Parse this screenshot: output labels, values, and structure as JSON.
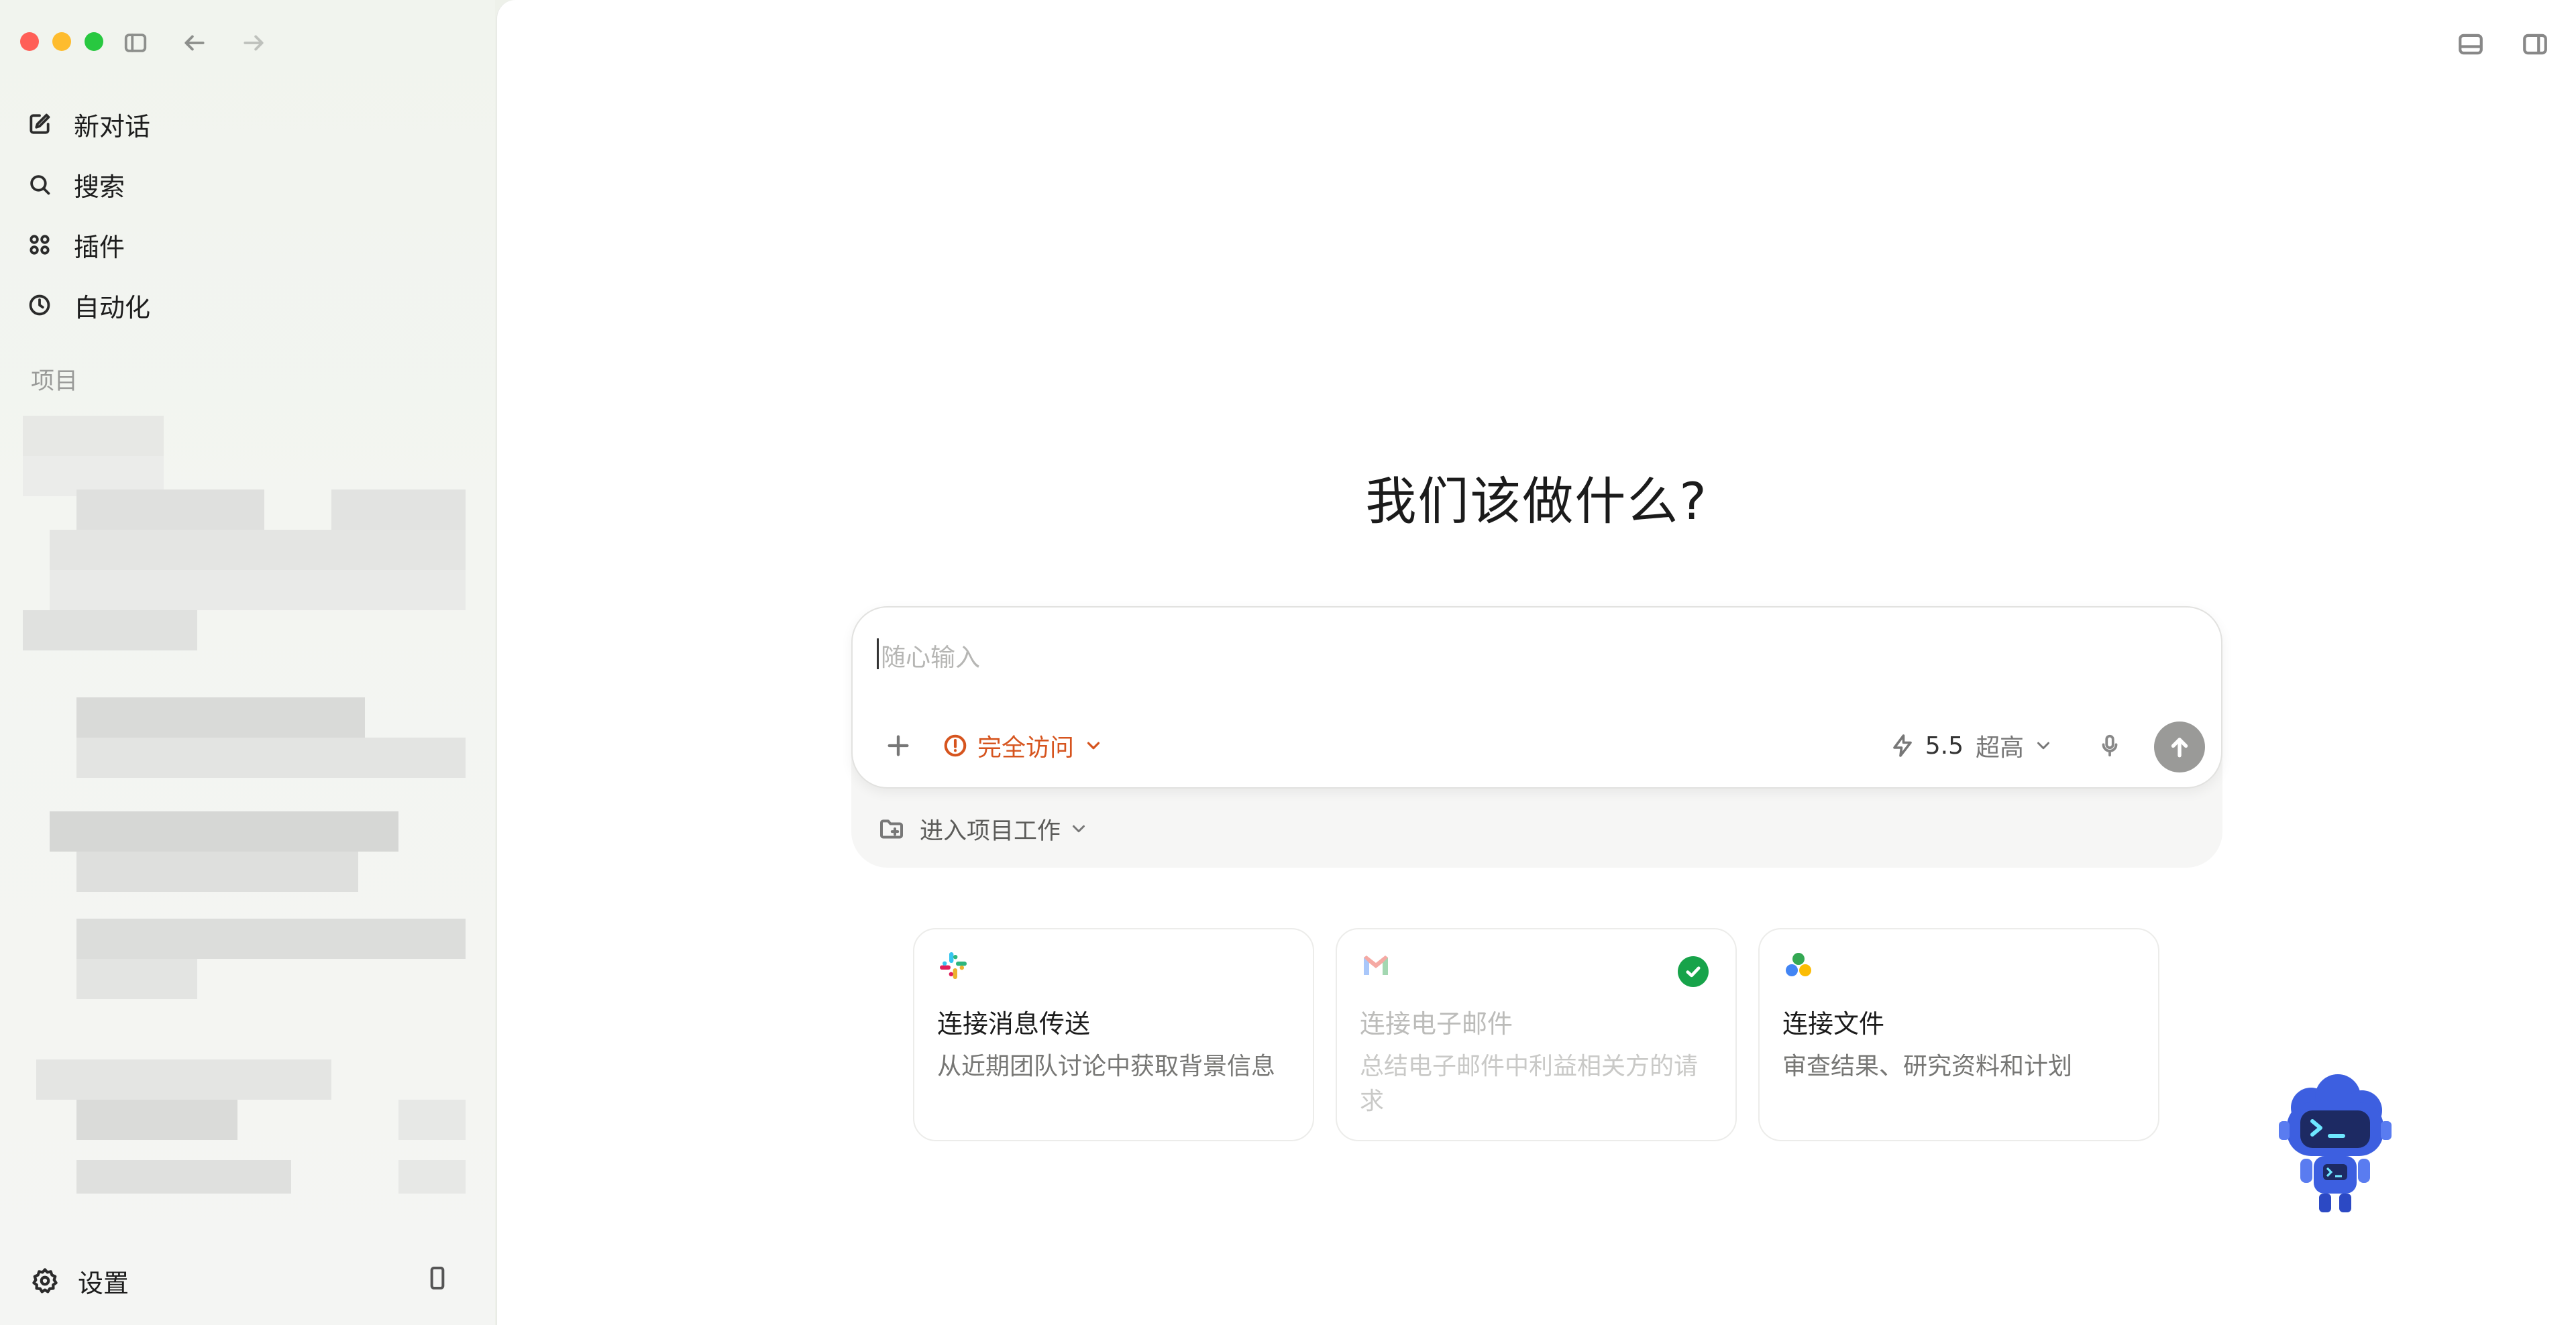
{
  "sidebar": {
    "nav": [
      {
        "label": "新对话",
        "icon": "compose-icon"
      },
      {
        "label": "搜索",
        "icon": "search-icon"
      },
      {
        "label": "插件",
        "icon": "plugins-icon"
      },
      {
        "label": "自动化",
        "icon": "clock-icon"
      }
    ],
    "section_title": "项目",
    "settings_label": "设置"
  },
  "main": {
    "headline": "我们该做什么?",
    "composer": {
      "placeholder": "随心输入",
      "access_label": "完全访问",
      "model_version": "5.5",
      "model_level": "超高",
      "project_label": "进入项目工作"
    },
    "cards": [
      {
        "title": "连接消息传送",
        "desc": "从近期团队讨论中获取背景信息",
        "icon": "slack-logo-icon",
        "connected": false,
        "dimmed": false
      },
      {
        "title": "连接电子邮件",
        "desc": "总结电子邮件中利益相关方的请求",
        "icon": "gmail-logo-icon",
        "connected": true,
        "dimmed": true
      },
      {
        "title": "连接文件",
        "desc": "审查结果、研究资料和计划",
        "icon": "drive-logo-icon",
        "connected": false,
        "dimmed": false
      }
    ]
  },
  "colors": {
    "accent_warning": "#d6541e",
    "connected_green": "#17a34a",
    "send_button": "#9a9a98"
  }
}
